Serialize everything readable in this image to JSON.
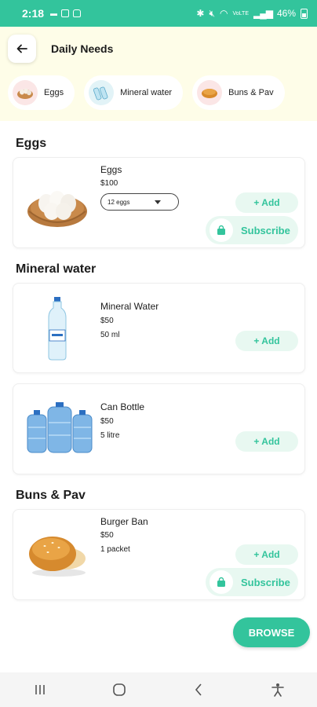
{
  "status_bar": {
    "time": "2:18",
    "battery": "46%",
    "network": "VoLTE"
  },
  "header": {
    "title": "Daily Needs"
  },
  "chips": [
    {
      "label": "Eggs",
      "icon": "egg-basket-icon"
    },
    {
      "label": "Mineral water",
      "icon": "water-bottle-icon"
    },
    {
      "label": "Buns & Pav",
      "icon": "bun-icon"
    }
  ],
  "sections": {
    "eggs": {
      "title": "Eggs",
      "products": [
        {
          "name": "Eggs",
          "price": "$100",
          "selected_option": "12 eggs",
          "add_label": "+ Add",
          "subscribe_label": "Subscribe"
        }
      ]
    },
    "water": {
      "title": "Mineral water",
      "products": [
        {
          "name": "Mineral Water",
          "price": "$50",
          "qty": "50 ml",
          "add_label": "+ Add"
        },
        {
          "name": "Can Bottle",
          "price": "$50",
          "qty": "5 litre",
          "add_label": "+ Add"
        }
      ]
    },
    "buns": {
      "title": "Buns & Pav",
      "products": [
        {
          "name": "Burger Ban",
          "price": "$50",
          "qty": "1 packet",
          "add_label": "+ Add",
          "subscribe_label": "Subscribe"
        }
      ]
    }
  },
  "browse_label": "BROWSE",
  "colors": {
    "accent": "#33c49c",
    "accent_light": "#e8f8f1",
    "header_bg": "#fefde8"
  }
}
